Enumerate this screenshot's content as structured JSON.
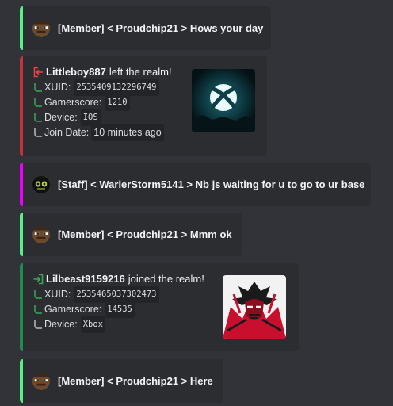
{
  "messages": [
    {
      "role": "[Member]",
      "text": " < Proudchip21 > Hows your day"
    },
    {
      "role": "[Staff]",
      "text": " < WarierStorm5141 > Nb js waiting for u to go to ur base"
    },
    {
      "role": "[Member]",
      "text": " < Proudchip21 > Mmm ok"
    },
    {
      "role": "[Member]",
      "text": " < Proudchip21 > Here"
    }
  ],
  "leave_embed": {
    "player": "Littleboy887",
    "action": "left the realm!",
    "xuid_label": "XUID:",
    "xuid": "2535409132296749",
    "gamerscore_label": "Gamerscore:",
    "gamerscore": "1210",
    "device_label": "Device:",
    "device": "IOS",
    "join_label": "Join Date:",
    "join_date": "10 minutes ago",
    "icon": "leave-arrow-icon",
    "thumbnail": "xbox-logo-icon"
  },
  "join_embed": {
    "player": "Lilbeast9159216",
    "action": "joined the realm!",
    "xuid_label": "XUID:",
    "xuid": "2535465037302473",
    "gamerscore_label": "Gamerscore:",
    "gamerscore": "14535",
    "device_label": "Device:",
    "device": "Xbox",
    "icon": "join-arrow-icon",
    "thumbnail": "samurai-mask-icon"
  },
  "colors": {
    "background": "#313338",
    "embed": "#2b2d31",
    "member_bar": "#57f287",
    "staff_bar": "#eb00ff",
    "leave_bar": "#c0323d",
    "join_bar": "#1f8b4c",
    "leave_icon": "#ed4245",
    "join_icon": "#3ba55c",
    "branch": "#3ba55c"
  }
}
